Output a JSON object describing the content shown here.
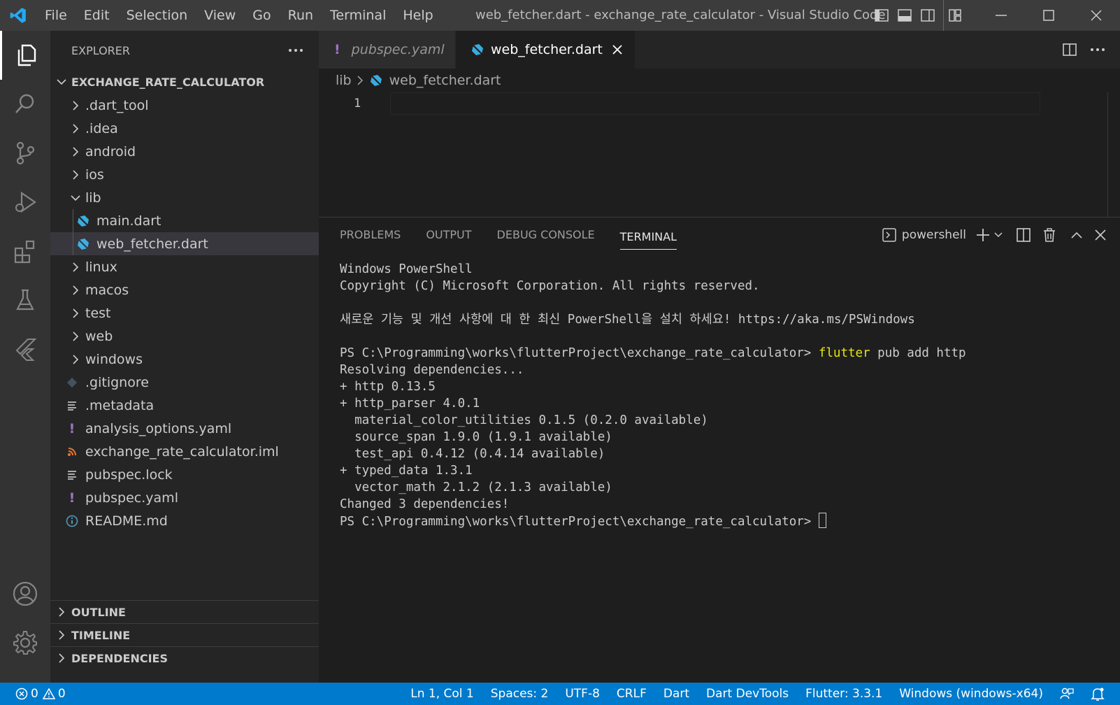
{
  "window": {
    "title": "web_fetcher.dart - exchange_rate_calculator - Visual Studio Code",
    "menu": [
      "File",
      "Edit",
      "Selection",
      "View",
      "Go",
      "Run",
      "Terminal",
      "Help"
    ]
  },
  "sidebar": {
    "header": "EXPLORER",
    "root": "EXCHANGE_RATE_CALCULATOR",
    "folders": [
      ".dart_tool",
      ".idea",
      "android",
      "ios"
    ],
    "lib": {
      "label": "lib",
      "children": [
        "main.dart",
        "web_fetcher.dart"
      ]
    },
    "folders2": [
      "linux",
      "macos",
      "test",
      "web",
      "windows"
    ],
    "files": [
      ".gitignore",
      ".metadata",
      "analysis_options.yaml",
      "exchange_rate_calculator.iml",
      "pubspec.lock",
      "pubspec.yaml",
      "README.md"
    ],
    "sections": [
      "OUTLINE",
      "TIMELINE",
      "DEPENDENCIES"
    ]
  },
  "tabs": [
    {
      "label": "pubspec.yaml",
      "active": false
    },
    {
      "label": "web_fetcher.dart",
      "active": true
    }
  ],
  "breadcrumb": {
    "folder": "lib",
    "file": "web_fetcher.dart"
  },
  "editor": {
    "line_number": "1"
  },
  "panel": {
    "tabs": [
      "PROBLEMS",
      "OUTPUT",
      "DEBUG CONSOLE",
      "TERMINAL"
    ],
    "shell": "powershell",
    "terminal": {
      "l1": "Windows PowerShell",
      "l2": "Copyright (C) Microsoft Corporation. All rights reserved.",
      "l3": "새로운 기능 및 개선 사항에 대 한 최신 PowerShell을 설치 하세요! https://aka.ms/PSWindows",
      "prompt": "PS C:\\Programming\\works\\flutterProject\\exchange_rate_calculator> ",
      "cmd_highlight": "flutter",
      "cmd_rest": " pub add http",
      "out": [
        "Resolving dependencies...",
        "+ http 0.13.5",
        "+ http_parser 4.0.1",
        "  material_color_utilities 0.1.5 (0.2.0 available)",
        "  source_span 1.9.0 (1.9.1 available)",
        "  test_api 0.4.12 (0.4.14 available)",
        "+ typed_data 1.3.1",
        "  vector_math 2.1.2 (2.1.3 available)",
        "Changed 3 dependencies!"
      ]
    }
  },
  "status": {
    "errors": "0",
    "warnings": "0",
    "position": "Ln 1, Col 1",
    "spaces": "Spaces: 2",
    "encoding": "UTF-8",
    "eol": "CRLF",
    "language": "Dart",
    "devtools": "Dart DevTools",
    "flutter": "Flutter: 3.3.1",
    "device": "Windows (windows-x64)"
  },
  "colors": {
    "statusbar": "#007acc",
    "accent_vscode": "#23a9f2",
    "terminal_highlight": "#e5e510",
    "yaml_icon": "#a074c4",
    "dart_icon": "#40c4ff"
  }
}
